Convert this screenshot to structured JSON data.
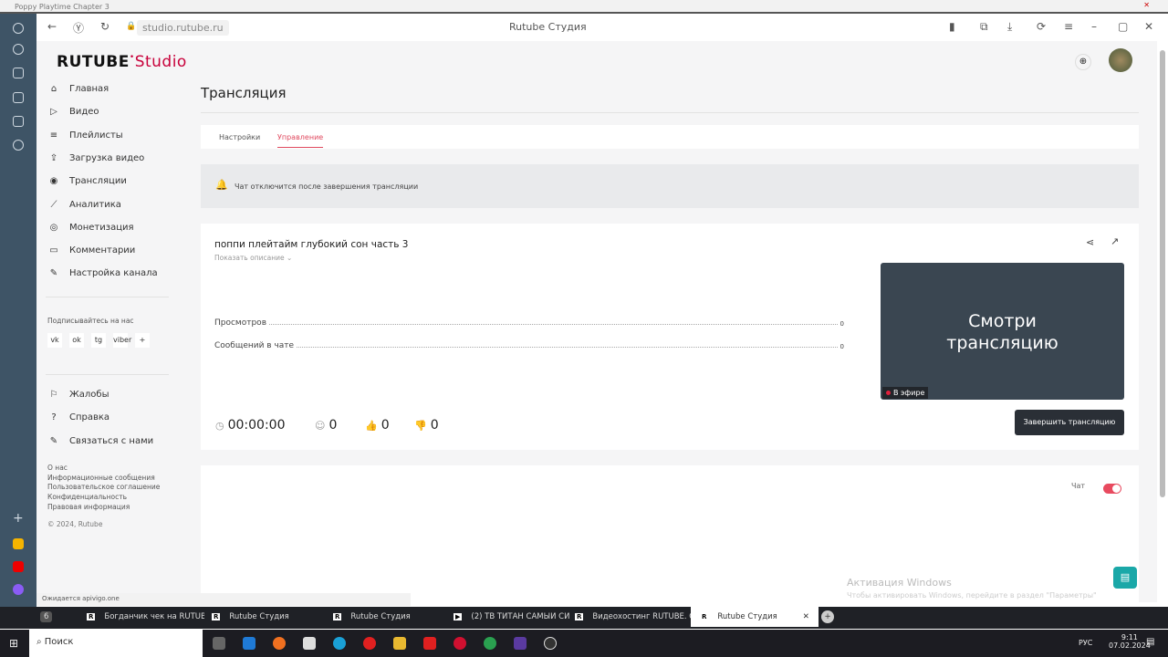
{
  "window": {
    "title": "Poppy Playtime Chapter 3"
  },
  "browser": {
    "url": "studio.rutube.ru",
    "page_title": "Rutube Студия",
    "status": "Ожидается apivigo.one",
    "tabs": [
      {
        "label": "Богданчик чек на RUTUBE"
      },
      {
        "label": "Rutube Студия"
      },
      {
        "label": "Rutube Студия"
      },
      {
        "label": "(2) ТВ ТИТАН САМЫЙ СИ"
      },
      {
        "label": "Видеохостинг RUTUBE. См"
      },
      {
        "label": "Rutube Студия",
        "active": true
      }
    ],
    "tab_count": "6"
  },
  "logo": {
    "brand": "RUTUBE",
    "studio": "Studio"
  },
  "sidebar": {
    "items": [
      {
        "label": "Главная",
        "icon": "⌂"
      },
      {
        "label": "Видео",
        "icon": "▷"
      },
      {
        "label": "Плейлисты",
        "icon": "≡"
      },
      {
        "label": "Загрузка видео",
        "icon": "⇪"
      },
      {
        "label": "Трансляции",
        "icon": "◉"
      },
      {
        "label": "Аналитика",
        "icon": "⟋"
      },
      {
        "label": "Монетизация",
        "icon": "◎"
      },
      {
        "label": "Комментарии",
        "icon": "▭"
      },
      {
        "label": "Настройка канала",
        "icon": "✎"
      }
    ],
    "subscribe": "Подписывайтесь на нас",
    "socials": [
      "vk",
      "ok",
      "tg",
      "viber",
      "+"
    ],
    "bottom_items": [
      {
        "label": "Жалобы",
        "icon": "⚐"
      },
      {
        "label": "Справка",
        "icon": "?"
      },
      {
        "label": "Связаться с нами",
        "icon": "✎"
      }
    ],
    "links": [
      "О нас",
      "Информационные сообщения",
      "Пользовательское соглашение",
      "Конфиденциальность",
      "Правовая информация"
    ],
    "copyright": "© 2024, Rutube"
  },
  "main": {
    "title": "Трансляция",
    "tabs": [
      "Настройки",
      "Управление"
    ],
    "active_tab": "Управление",
    "alert": "Чат отключится после завершения трансляции",
    "stream_title": "поппи плейтайм глубокий сон часть 3",
    "show_description": "Показать описание",
    "stats": [
      {
        "label": "Просмотров",
        "value": "0"
      },
      {
        "label": "Сообщений в чате",
        "value": "0"
      }
    ],
    "duration": "00:00:00",
    "viewers": "0",
    "likes": "0",
    "dislikes": "0",
    "preview_text_1": "Смотри",
    "preview_text_2": "трансляцию",
    "live_badge": "В эфире",
    "end_button": "Завершить трансляцию",
    "chat_label": "Чат",
    "chat_enabled": true
  },
  "watermark": {
    "line1": "Активация Windows",
    "line2": "Чтобы активировать Windows, перейдите в раздел \"Параметры\""
  },
  "taskbar": {
    "search": "Поиск",
    "lang": "РУС",
    "time": "9:11",
    "date": "07.02.2024"
  },
  "colors": {
    "accent": "#c8003a",
    "toggle": "#e84a5f",
    "video_bg": "#3a4651"
  }
}
